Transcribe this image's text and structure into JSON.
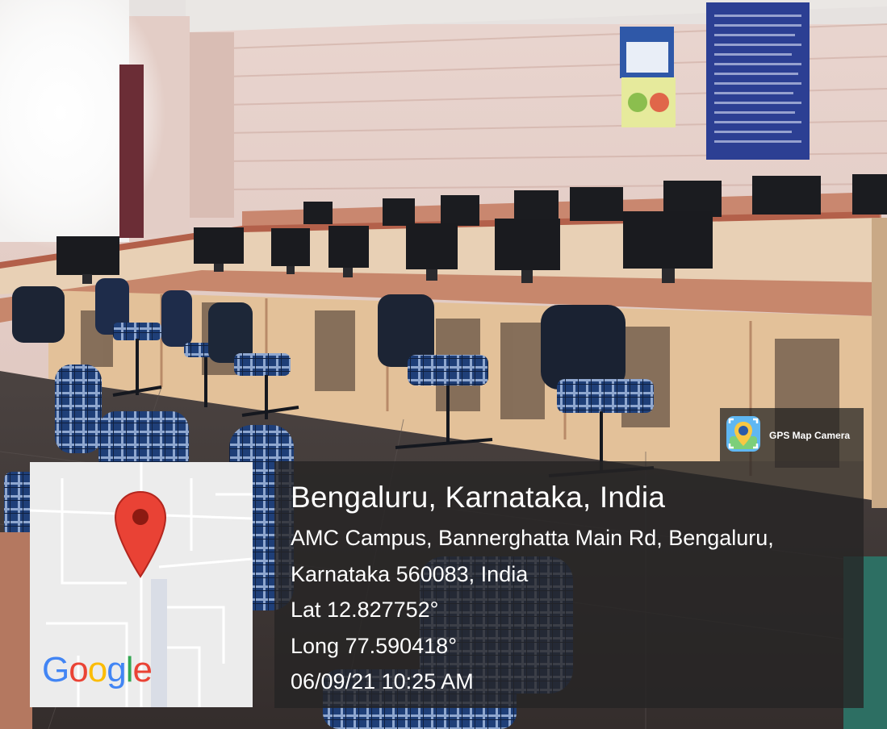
{
  "overlay": {
    "location_title": "Bengaluru, Karnataka, India",
    "address_line1": "AMC Campus, Bannerghatta Main Rd, Bengaluru,",
    "address_line2": "Karnataka 560083, India",
    "latitude": "Lat 12.827752°",
    "longitude": "Long 77.590418°",
    "datetime": "06/09/21 10:25 AM"
  },
  "app_badge": {
    "label": "GPS Map Camera",
    "icon": "gps-camera-icon"
  },
  "map_thumbnail": {
    "provider_logo": "Google",
    "pin_icon": "map-pin-icon",
    "pin_color": "#e94235"
  },
  "brand_colors": {
    "g_blue": "#4285F4",
    "o_red": "#EA4335",
    "o_yellow": "#FBBC05",
    "l_green": "#34A853"
  }
}
